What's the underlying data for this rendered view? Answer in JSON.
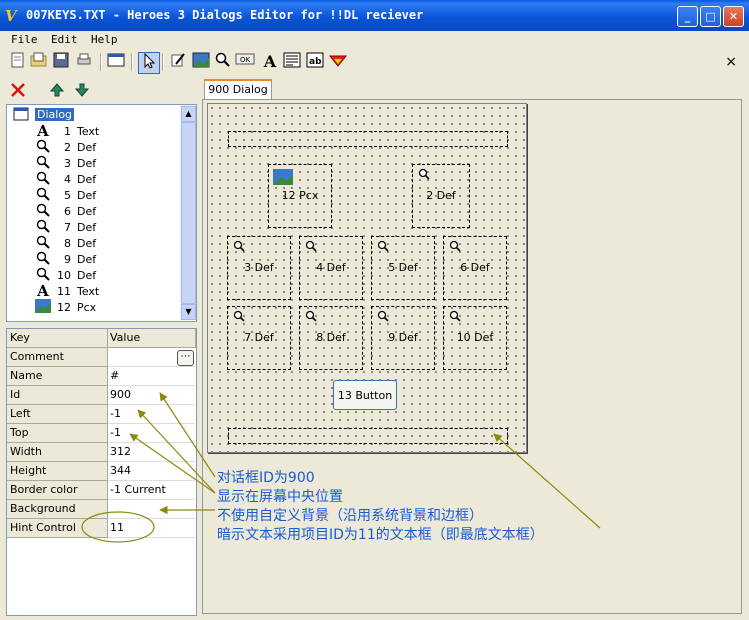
{
  "window": {
    "title": "007KEYS.TXT - Heroes 3 Dialogs Editor for !!DL reciever",
    "app_icon": "V"
  },
  "caption_buttons": {
    "minimize": "_",
    "maximize": "□",
    "close": "✕"
  },
  "menu": [
    "File",
    "Edit",
    "Help"
  ],
  "toolbar_close": "×",
  "tree": {
    "root": "Dialog",
    "items": [
      {
        "id": "1",
        "type": "Text",
        "icon": "A"
      },
      {
        "id": "2",
        "type": "Def",
        "icon": "🔍"
      },
      {
        "id": "3",
        "type": "Def",
        "icon": "🔍"
      },
      {
        "id": "4",
        "type": "Def",
        "icon": "🔍"
      },
      {
        "id": "5",
        "type": "Def",
        "icon": "🔍"
      },
      {
        "id": "6",
        "type": "Def",
        "icon": "🔍"
      },
      {
        "id": "7",
        "type": "Def",
        "icon": "🔍"
      },
      {
        "id": "8",
        "type": "Def",
        "icon": "🔍"
      },
      {
        "id": "9",
        "type": "Def",
        "icon": "🔍"
      },
      {
        "id": "10",
        "type": "Def",
        "icon": "🔍"
      },
      {
        "id": "11",
        "type": "Text",
        "icon": "A"
      },
      {
        "id": "12",
        "type": "Pcx",
        "icon": "▦"
      }
    ]
  },
  "props": {
    "header": {
      "key": "Key",
      "value": "Value"
    },
    "rows": [
      {
        "key": "Comment",
        "value": ""
      },
      {
        "key": "Name",
        "value": "#"
      },
      {
        "key": "Id",
        "value": "900"
      },
      {
        "key": "Left",
        "value": "-1"
      },
      {
        "key": "Top",
        "value": "-1"
      },
      {
        "key": "Width",
        "value": "312"
      },
      {
        "key": "Height",
        "value": "344"
      },
      {
        "key": "Border color",
        "value": "-1 Current"
      },
      {
        "key": "Background",
        "value": ""
      },
      {
        "key": "Hint Control",
        "value": "11"
      }
    ],
    "comment_button": "⋯"
  },
  "tab": "900 Dialog",
  "controls": {
    "pcx12": "12 Pcx",
    "def2": "2 Def",
    "def3": "3 Def",
    "def4": "4 Def",
    "def5": "5 Def",
    "def6": "6 Def",
    "def7": "7 Def",
    "def8": "8 Def",
    "def9": "9 Def",
    "def10": "10 Def",
    "button13": "13 Button"
  },
  "annotations": [
    "对话框ID为900",
    "显示在屏幕中央位置",
    "不使用自定义背景（沿用系统背景和边框）",
    "暗示文本采用项目ID为11的文本框（即最底文本框）"
  ],
  "colors": {
    "annotation_text": "#1a5ad6",
    "annotation_arrow": "#8a8a10",
    "titlebar": "#0a58e0"
  }
}
